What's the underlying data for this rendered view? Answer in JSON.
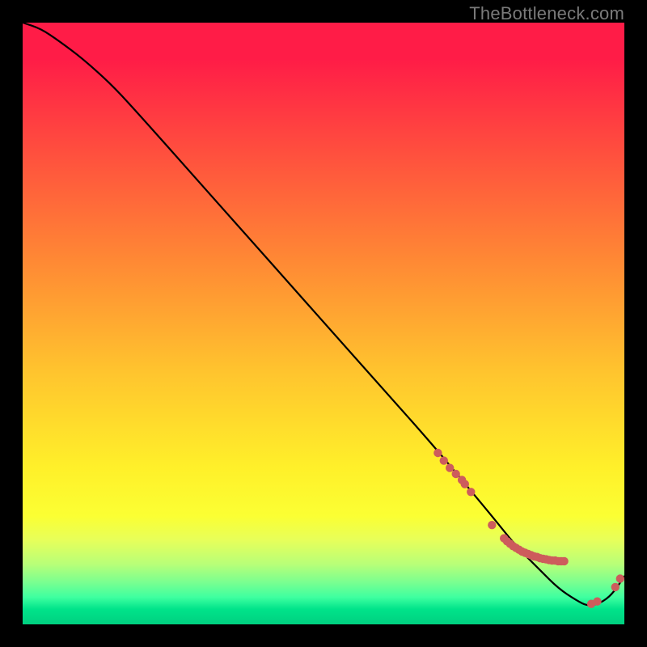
{
  "watermark": "TheBottleneck.com",
  "chart_data": {
    "type": "line",
    "title": "",
    "xlabel": "",
    "ylabel": "",
    "xlim": [
      0,
      100
    ],
    "ylim": [
      0,
      100
    ],
    "series": [
      {
        "name": "bottleneck-curve",
        "x": [
          0,
          3,
          6,
          10,
          15,
          20,
          28,
          36,
          44,
          52,
          60,
          68,
          73,
          78,
          82,
          86,
          89,
          92,
          94,
          96,
          98,
          100
        ],
        "values": [
          100,
          99,
          97,
          94,
          89.5,
          84,
          75,
          66,
          57,
          48,
          39,
          30,
          24,
          18,
          13,
          9,
          6,
          4,
          3,
          3.5,
          5,
          8
        ]
      }
    ],
    "scatter": {
      "name": "marker-dots",
      "color": "#cd5c5c",
      "x": [
        69,
        70,
        71,
        72,
        73,
        73.5,
        74.5,
        78,
        80,
        80.5,
        81,
        81.5,
        82,
        82.5,
        83,
        83.5,
        84,
        84.5,
        85,
        85.5,
        86,
        86.5,
        87,
        87.5,
        88,
        88.5,
        89,
        89.5,
        90,
        94.5,
        95.5,
        98.5,
        99.3
      ],
      "values": [
        28.5,
        27.2,
        26,
        25,
        24,
        23.3,
        22,
        16.5,
        14.3,
        13.8,
        13.4,
        13,
        12.7,
        12.4,
        12.1,
        11.9,
        11.7,
        11.5,
        11.3,
        11.2,
        11,
        10.9,
        10.8,
        10.7,
        10.6,
        10.6,
        10.5,
        10.5,
        10.5,
        3.4,
        3.8,
        6.2,
        7.6
      ]
    }
  }
}
